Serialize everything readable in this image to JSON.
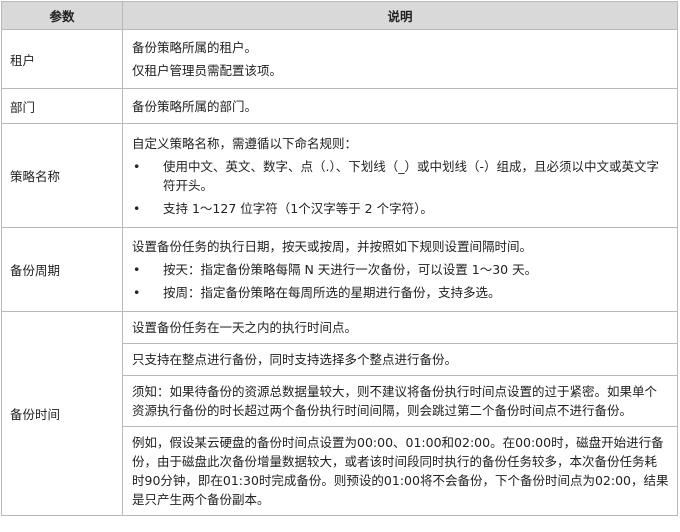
{
  "header": {
    "col_param": "参数",
    "col_desc": "说明"
  },
  "rows": [
    {
      "name": "租户",
      "paras": [
        "备份策略所属的租户。",
        "仅租户管理员需配置该项。"
      ]
    },
    {
      "name": "部门",
      "paras": [
        "备份策略所属的部门。"
      ]
    },
    {
      "name": "策略名称",
      "intro": "自定义策略名称，需遵循以下命名规则：",
      "bullets": [
        "使用中文、英文、数字、点（.）、下划线（_）或中划线（-）组成，且必须以中文或英文字符开头。",
        "支持 1～127 位字符（1个汉字等于 2 个字符）。"
      ]
    },
    {
      "name": "备份周期",
      "intro": "设置备份任务的执行日期，按天或按周，并按照如下规则设置间隔时间。",
      "bullets": [
        "按天：指定备份策略每隔 N 天进行一次备份，可以设置 1～30 天。",
        "按周：指定备份策略在每周所选的星期进行备份，支持多选。"
      ]
    },
    {
      "name": "备份时间",
      "sub": [
        "设置备份任务在一天之内的执行时间点。",
        "只支持在整点进行备份，同时支持选择多个整点进行备份。",
        "须知：如果待备份的资源总数据量较大，则不建议将备份执行时间点设置的过于紧密。如果单个资源执行备份的时长超过两个备份执行时间间隔，则会跳过第二个备份时间点不进行备份。",
        "例如，假设某云硬盘的备份时间点设置为00:00、01:00和02:00。在00:00时，磁盘开始进行备份，由于磁盘此次备份增量数据较大，或者该时间段同时执行的备份任务较多，本次备份任务耗时90分钟，即在01:30时完成备份。则预设的01:00将不会备份，下个备份时间点为02:00，结果是只产生两个备份副本。"
      ]
    }
  ]
}
